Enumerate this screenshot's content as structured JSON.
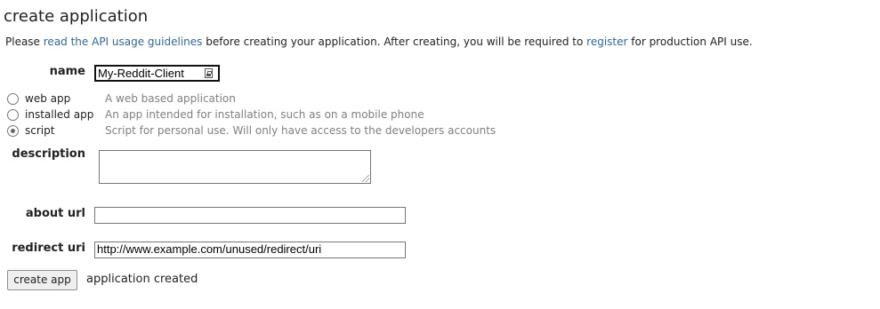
{
  "title": "create application",
  "intro": {
    "prefix": "Please ",
    "guidelines_link": "read the API usage guidelines",
    "middle": " before creating your application. After creating, you will be required to ",
    "register_link": "register",
    "suffix": " for production API use."
  },
  "form": {
    "name_label": "name",
    "name_value": "My-Reddit-Client",
    "app_types": [
      {
        "label": "web app",
        "description": "A web based application",
        "checked": false
      },
      {
        "label": "installed app",
        "description": "An app intended for installation, such as on a mobile phone",
        "checked": false
      },
      {
        "label": "script",
        "description": "Script for personal use. Will only have access to the developers accounts",
        "checked": true
      }
    ],
    "description_label": "description",
    "description_value": "",
    "about_url_label": "about url",
    "about_url_value": "",
    "redirect_uri_label": "redirect uri",
    "redirect_uri_value": "http://www.example.com/unused/redirect/uri"
  },
  "actions": {
    "create_button": "create app",
    "status_text": "application created"
  },
  "colors": {
    "link": "#336699",
    "muted_text": "#808080",
    "text": "#222222"
  }
}
